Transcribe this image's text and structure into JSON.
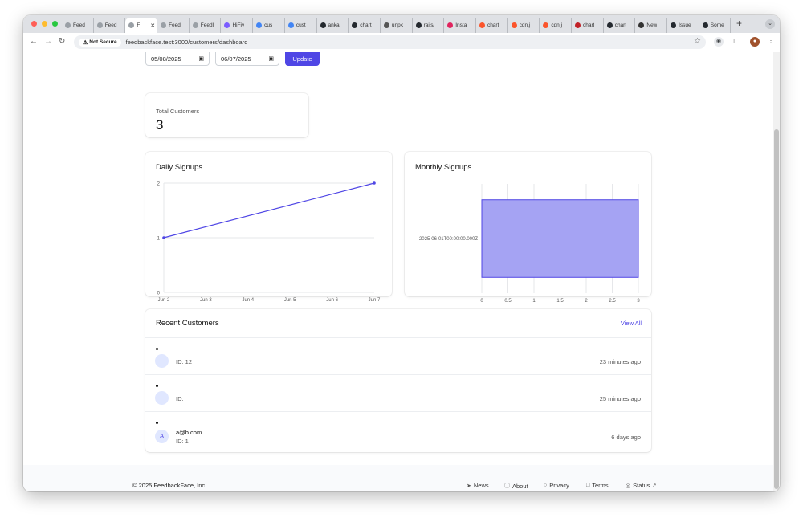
{
  "browser": {
    "tabs": [
      {
        "title": "Feed",
        "icon_color": "#9aa0a6",
        "icon": "smile-icon"
      },
      {
        "title": "Feed",
        "icon_color": "#9aa0a6",
        "icon": "smile-icon"
      },
      {
        "title": "F",
        "icon_color": "#9aa0a6",
        "icon": "smile-icon",
        "active": true
      },
      {
        "title": "Feedl",
        "icon_color": "#9aa0a6",
        "icon": "smile-icon"
      },
      {
        "title": "Feedl",
        "icon_color": "#9aa0a6",
        "icon": "smile-icon"
      },
      {
        "title": "HiFiv",
        "icon_color": "#7b5cff",
        "icon": "hifive-icon"
      },
      {
        "title": "cus",
        "icon_color": "#4285f4",
        "icon": "google-icon"
      },
      {
        "title": "cust",
        "icon_color": "#4285f4",
        "icon": "google-icon"
      },
      {
        "title": "anka",
        "icon_color": "#24292f",
        "icon": "github-icon"
      },
      {
        "title": "chart",
        "icon_color": "#24292f",
        "icon": "github-icon"
      },
      {
        "title": "unpk",
        "icon_color": "#555555",
        "icon": "globe-icon"
      },
      {
        "title": "rails/",
        "icon_color": "#24292f",
        "icon": "github-icon"
      },
      {
        "title": "Insta",
        "icon_color": "#e0245e",
        "icon": "lips-icon"
      },
      {
        "title": "chart",
        "icon_color": "#fb542b",
        "icon": "brave-icon"
      },
      {
        "title": "cdn.j",
        "icon_color": "#fb542b",
        "icon": "brave-icon"
      },
      {
        "title": "cdn.j",
        "icon_color": "#fb542b",
        "icon": "brave-icon"
      },
      {
        "title": "chart",
        "icon_color": "#c12127",
        "icon": "npm-icon"
      },
      {
        "title": "chart",
        "icon_color": "#24292f",
        "icon": "github-icon"
      },
      {
        "title": "New",
        "icon_color": "#333333",
        "icon": "openai-icon"
      },
      {
        "title": "Issue",
        "icon_color": "#24292f",
        "icon": "github-icon"
      },
      {
        "title": "Some",
        "icon_color": "#24292f",
        "icon": "github-icon"
      }
    ],
    "tab_close": "✕",
    "new_tab": "+",
    "tab_menu": "⌄",
    "not_secure": "Not Secure",
    "url": "feedbackface.test:3000/customers/dashboard"
  },
  "filters": {
    "start_date": "05/08/2025",
    "end_date": "06/07/2025",
    "update_label": "Update"
  },
  "stats": {
    "total_label": "Total Customers",
    "total_value": "3"
  },
  "daily": {
    "title": "Daily Signups"
  },
  "monthly": {
    "title": "Monthly Signups"
  },
  "chart_data": [
    {
      "type": "line",
      "title": "Daily Signups",
      "x": [
        "Jun 2",
        "Jun 3",
        "Jun 4",
        "Jun 5",
        "Jun 6",
        "Jun 7"
      ],
      "series": [
        {
          "points": [
            {
              "x": "Jun 2",
              "y": 1
            },
            {
              "x": "Jun 7",
              "y": 2
            }
          ]
        }
      ],
      "yticks": [
        "0",
        "1",
        "2"
      ],
      "ylim": [
        0,
        2
      ],
      "color": "#4f46e5",
      "grid": true
    },
    {
      "type": "bar",
      "orientation": "horizontal",
      "title": "Monthly Signups",
      "categories": [
        "2025-06-01T00:00:00.000Z"
      ],
      "values": [
        3
      ],
      "xticks": [
        "0",
        "0.5",
        "1",
        "1.5",
        "2",
        "2.5",
        "3"
      ],
      "xlim": [
        0,
        3
      ],
      "fill": "#a5a3f3",
      "stroke": "#4f46e5",
      "grid": true
    }
  ],
  "recent": {
    "title": "Recent Customers",
    "view_all": "View All",
    "customers": [
      {
        "email": "",
        "avatar": "",
        "id_text": "ID: 12",
        "time": "23 minutes ago"
      },
      {
        "email": "",
        "avatar": "",
        "id_text": "ID:",
        "time": "25 minutes ago"
      },
      {
        "email": "a@b.com",
        "avatar": "A",
        "id_text": "ID: 1",
        "time": "6 days ago"
      }
    ]
  },
  "footer": {
    "copyright": "© 2025 FeedbackFace, Inc.",
    "links": [
      {
        "label": "News",
        "icon": "megaphone-icon"
      },
      {
        "label": "About",
        "icon": "info-icon"
      },
      {
        "label": "Privacy",
        "icon": "lock-icon"
      },
      {
        "label": "Terms",
        "icon": "document-icon"
      },
      {
        "label": "Status",
        "icon": "status-icon"
      }
    ]
  }
}
